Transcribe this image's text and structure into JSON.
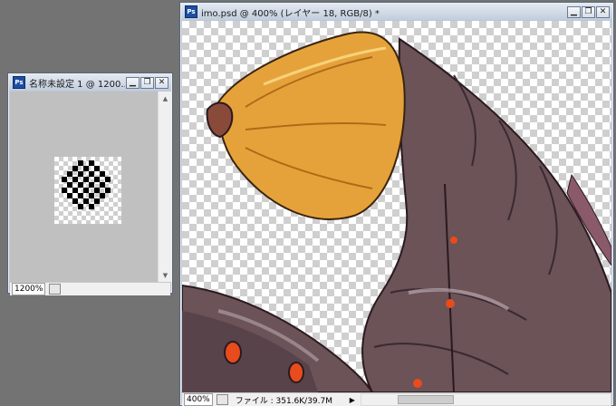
{
  "small_window": {
    "title": "名称未設定 1 @ 1200...",
    "zoom": "1200%",
    "controls": [
      "minimize",
      "restore",
      "close"
    ]
  },
  "main_window": {
    "title": "imo.psd @ 400% (レイヤー 18, RGB/8) *",
    "zoom": "400%",
    "file_info": "ファイル : 351.6K/39.7M",
    "controls": [
      "minimize",
      "restore",
      "close"
    ]
  },
  "icons": {
    "app": "photoshop-icon",
    "minimize": "minimize-icon",
    "restore": "restore-icon",
    "close": "close-icon"
  },
  "colors": {
    "desktop": "#737373",
    "canvas_bg": "#c0c0c0",
    "worm_body": "#6b5358",
    "worm_head": "#e6a23a",
    "spots": "#e84b1c"
  }
}
